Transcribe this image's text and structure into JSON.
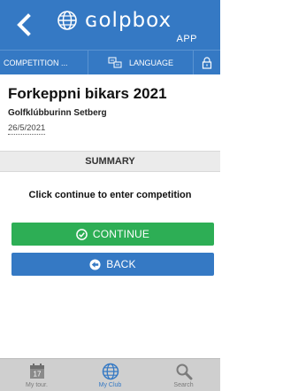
{
  "header": {
    "logo_text": "ɢolpbox",
    "logo_sub": "APP",
    "back_icon": "chevron-left-icon",
    "globe_icon": "globe-icon"
  },
  "tabs": [
    {
      "label": "COMPETITION ..."
    },
    {
      "label": "LANGUAGE",
      "icon": "language-icon"
    },
    {
      "label": "",
      "icon": "lock-icon"
    }
  ],
  "competition": {
    "title": "Forkeppni bikars 2021",
    "club": "Golfklúbburinn Setberg",
    "date": "26/5/2021"
  },
  "summary": {
    "heading": "SUMMARY",
    "instruction": "Click continue to enter competition"
  },
  "buttons": {
    "continue_label": "CONTINUE",
    "back_label": "BACK"
  },
  "bottom_nav": [
    {
      "label": "My tour.",
      "icon": "calendar-icon",
      "calendar_day": "17"
    },
    {
      "label": "My Club",
      "icon": "globe-icon",
      "active": true
    },
    {
      "label": "Search",
      "icon": "magnifier-icon"
    }
  ],
  "colors": {
    "primary_blue": "#3579c4",
    "continue_green": "#2dae55",
    "bottom_nav_bg": "#cfcfcf"
  }
}
